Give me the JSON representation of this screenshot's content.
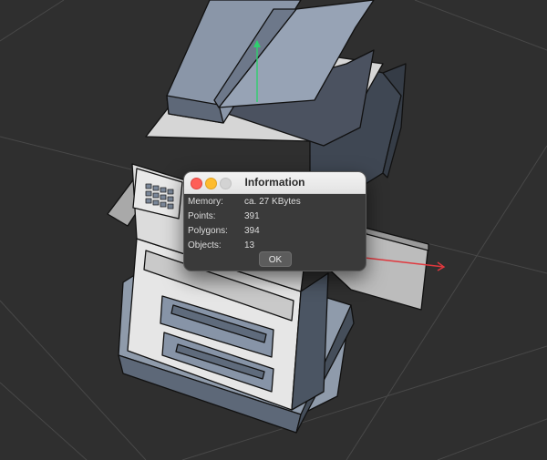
{
  "dialog": {
    "title": "Information",
    "rows": [
      {
        "label": "Memory:",
        "value": "ca. 27 KBytes"
      },
      {
        "label": "Points:",
        "value": "391"
      },
      {
        "label": "Polygons:",
        "value": "394"
      },
      {
        "label": "Objects:",
        "value": "13"
      }
    ],
    "ok_label": "OK"
  },
  "viewport": {
    "model": "photocopier",
    "background_color": "#2f2f2f",
    "grid_color": "#4a4a4a",
    "axis_y_color": "#2fcf6e",
    "axis_x_color": "#e0383e"
  }
}
